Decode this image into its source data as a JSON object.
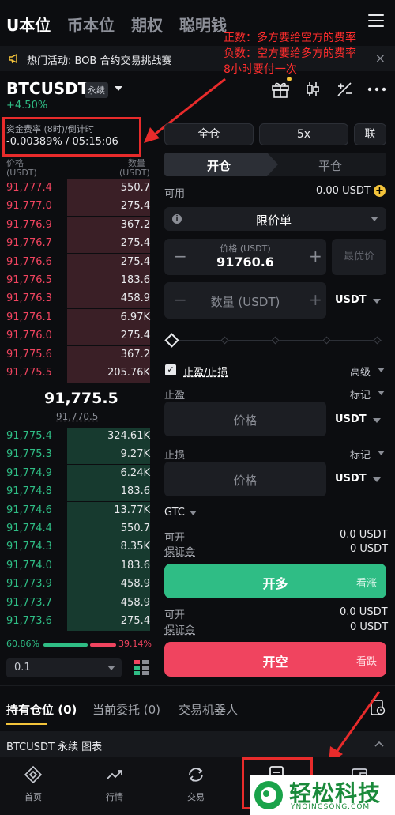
{
  "top_tabs": [
    "U本位",
    "币本位",
    "期权",
    "聪明钱"
  ],
  "announcement": {
    "text": "热门活动: BOB 合约交易挑战赛",
    "close": "×"
  },
  "annotation": {
    "line1": "正数：多方要给空方的费率",
    "line2": "负数：空方要给多方的费率",
    "line3": "8小时要付一次"
  },
  "symbol": {
    "name": "BTCUSDT",
    "tag": "永续",
    "change": "+4.50%"
  },
  "funding": {
    "label": "资金费率 (8时)/倒计时",
    "value": "-0.00389% / 05:15:06"
  },
  "orderbook": {
    "price_header": "价格",
    "price_unit": "(USDT)",
    "qty_header": "数量",
    "qty_unit": "(USDT)",
    "asks": [
      {
        "price": "91,777.4",
        "qty": "550.7",
        "depth": 0.55
      },
      {
        "price": "91,777.0",
        "qty": "275.4",
        "depth": 0.55
      },
      {
        "price": "91,776.9",
        "qty": "367.2",
        "depth": 0.55
      },
      {
        "price": "91,776.7",
        "qty": "275.4",
        "depth": 0.55
      },
      {
        "price": "91,776.6",
        "qty": "275.4",
        "depth": 0.55
      },
      {
        "price": "91,776.5",
        "qty": "183.6",
        "depth": 0.55
      },
      {
        "price": "91,776.3",
        "qty": "458.9",
        "depth": 0.55
      },
      {
        "price": "91,776.1",
        "qty": "6.97K",
        "depth": 0.55
      },
      {
        "price": "91,776.0",
        "qty": "275.4",
        "depth": 0.55
      },
      {
        "price": "91,775.6",
        "qty": "367.2",
        "depth": 0.55
      },
      {
        "price": "91,775.5",
        "qty": "205.76K",
        "depth": 0.55
      }
    ],
    "last_price": "91,775.5",
    "mark_price": "91,770.5",
    "bids": [
      {
        "price": "91,775.4",
        "qty": "324.61K",
        "depth": 0.55
      },
      {
        "price": "91,775.3",
        "qty": "9.27K",
        "depth": 0.55
      },
      {
        "price": "91,774.9",
        "qty": "6.24K",
        "depth": 0.55
      },
      {
        "price": "91,774.8",
        "qty": "183.6",
        "depth": 0.55
      },
      {
        "price": "91,774.6",
        "qty": "13.77K",
        "depth": 0.55
      },
      {
        "price": "91,774.4",
        "qty": "550.7",
        "depth": 0.55
      },
      {
        "price": "91,774.3",
        "qty": "8.35K",
        "depth": 0.55
      },
      {
        "price": "91,774.0",
        "qty": "183.6",
        "depth": 0.55
      },
      {
        "price": "91,773.9",
        "qty": "458.9",
        "depth": 0.55
      },
      {
        "price": "91,773.7",
        "qty": "458.9",
        "depth": 0.55
      },
      {
        "price": "91,773.6",
        "qty": "275.4",
        "depth": 0.55
      }
    ],
    "buy_ratio": "60.86%",
    "sell_ratio": "39.14%",
    "buy_ratio_value": 0.6086,
    "precision": "0.1"
  },
  "order_panel": {
    "margin_mode": "全仓",
    "leverage": "5x",
    "link": "联",
    "tab_open": "开仓",
    "tab_close": "平仓",
    "available_label": "可用",
    "available_value": "0.00 USDT",
    "order_type": "限价单",
    "price_label": "价格 (USDT)",
    "price_value": "91760.6",
    "best_price": "最优价",
    "qty_placeholder": "数量 (USDT)",
    "qty_unit": "USDT",
    "tpsl_label": "止盈/止损",
    "advanced": "高级",
    "tp_label": "止盈",
    "tp_mark": "标记",
    "tp_placeholder": "价格",
    "tp_unit": "USDT",
    "sl_label": "止损",
    "sl_mark": "标记",
    "sl_placeholder": "价格",
    "sl_unit": "USDT",
    "tif": "GTC",
    "long_open_label": "可开",
    "long_open_value": "0.0 USDT",
    "long_margin_label": "保证金",
    "long_margin_value": "0 USDT",
    "long_button": "开多",
    "long_hint": "看涨",
    "short_open_label": "可开",
    "short_open_value": "0.0 USDT",
    "short_margin_label": "保证金",
    "short_margin_value": "0 USDT",
    "short_button": "开空",
    "short_hint": "看跌"
  },
  "bottom_tabs": [
    "持有仓位 (0)",
    "当前委托 (0)",
    "交易机器人"
  ],
  "chart_bar": {
    "label": "BTCUSDT 永续 图表"
  },
  "nav": [
    "首页",
    "行情",
    "交易"
  ],
  "watermark": {
    "title": "轻松科技",
    "url": "YNQINGSONG.COM"
  },
  "colors": {
    "up": "#2fbd85",
    "down": "#f0445f",
    "annotation": "#ff2d2d",
    "accent": "#f3c33b"
  }
}
